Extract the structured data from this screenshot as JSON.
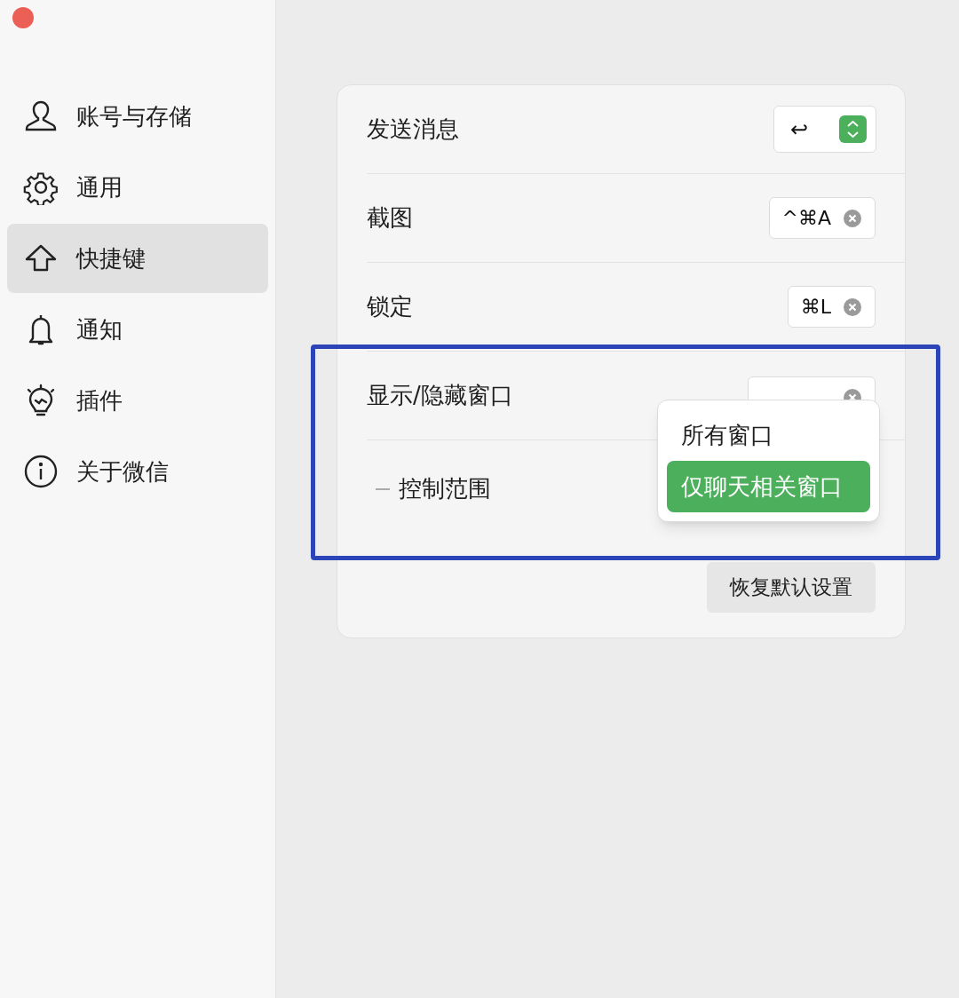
{
  "window": {
    "controls": [
      {
        "kind": "close",
        "color": "#ec5f57"
      }
    ]
  },
  "sidebar": {
    "items": [
      {
        "label": "账号与存储",
        "selected": false
      },
      {
        "label": "通用",
        "selected": false
      },
      {
        "label": "快捷键",
        "selected": true
      },
      {
        "label": "通知",
        "selected": false
      },
      {
        "label": "插件",
        "selected": false
      },
      {
        "label": "关于微信",
        "selected": false
      }
    ]
  },
  "settings": {
    "rows": [
      {
        "label": "发送消息",
        "kind": "select",
        "value": "↩"
      },
      {
        "label": "截图",
        "kind": "shortcut",
        "value": "^⌘A"
      },
      {
        "label": "锁定",
        "kind": "shortcut",
        "value": "⌘L"
      },
      {
        "label": "显示/隐藏窗口",
        "kind": "shortcut"
      },
      {
        "label": "控制范围",
        "kind": "sub"
      }
    ],
    "reset_button": "恢复默认设置"
  },
  "popup_menu": {
    "options": [
      {
        "label": "所有窗口",
        "selected": false
      },
      {
        "label": "仅聊天相关窗口",
        "selected": true
      }
    ]
  },
  "annotation": {
    "kind": "highlight-frame",
    "color": "#2b45b8"
  }
}
